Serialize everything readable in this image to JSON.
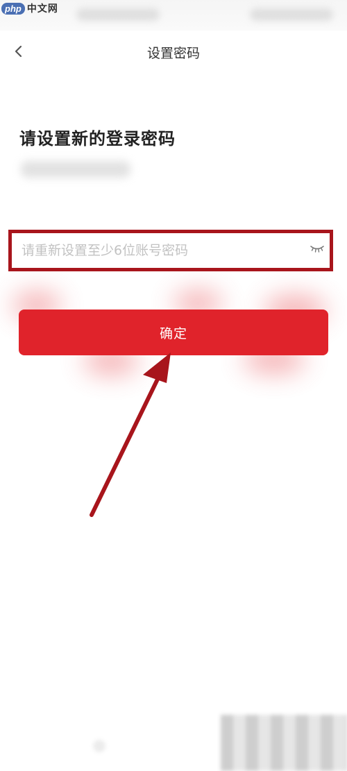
{
  "watermark": {
    "logo": "php",
    "text": "中文网"
  },
  "nav": {
    "back_icon": "chevron-left-icon",
    "title": "设置密码"
  },
  "heading": "请设置新的登录密码",
  "password": {
    "value": "",
    "placeholder": "请重新设置至少6位账号密码",
    "toggle_icon": "eye-closed-icon"
  },
  "confirm_button": {
    "label": "确定"
  },
  "colors": {
    "primary": "#e0232b",
    "annotation": "#a8151c",
    "placeholder": "#c2c2c2",
    "title": "#333333"
  }
}
